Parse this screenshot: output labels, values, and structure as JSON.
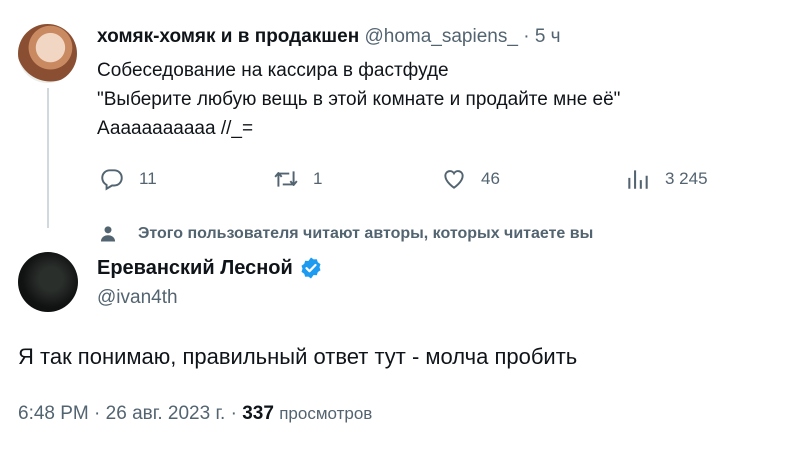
{
  "tweet1": {
    "author_name": "хомяк-хомяк и в продакшен",
    "handle": "@homa_sapiens_",
    "separator": "·",
    "time": "5 ч",
    "lines": [
      "Собеседование на кассира в фастфуде",
      "\"Выберите любую вещь в этой комнате и продайте мне её\"",
      "Ааааааааааа //_="
    ],
    "replies": "11",
    "retweets": "1",
    "likes": "46",
    "views": "3 245"
  },
  "follow_note": "Этого пользователя читают авторы, которых читаете вы",
  "tweet2": {
    "author_name": "Ереванский Лесной",
    "handle": "@ivan4th",
    "text": "Я так понимаю, правильный ответ тут - молча пробить",
    "time": "6:48 PM",
    "date": "26 авг. 2023 г.",
    "separator": "·",
    "views_count": "337",
    "views_label": "просмотров"
  },
  "colors": {
    "text_primary": "#0f1419",
    "text_secondary": "#536471",
    "thread_line": "#cfd9de",
    "verified_blue": "#1d9bf0"
  },
  "icons": [
    "reply-icon",
    "retweet-icon",
    "like-icon",
    "views-icon",
    "person-icon",
    "verified-badge-icon"
  ]
}
